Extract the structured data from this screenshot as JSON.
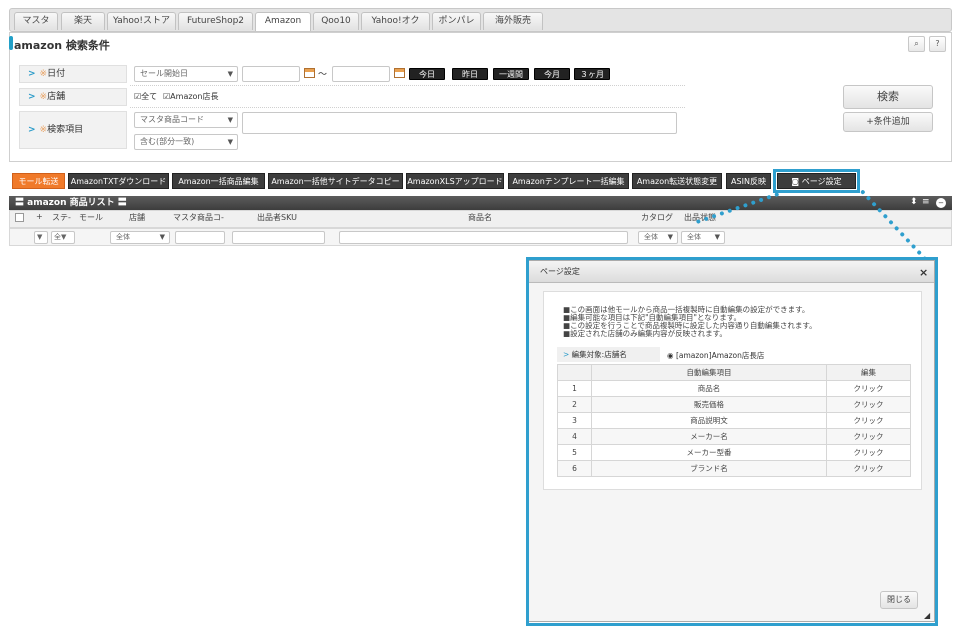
{
  "tabs": [
    "マスタ",
    "楽天",
    "Yahoo!ストア",
    "FutureShop2",
    "Amazon",
    "Qoo10",
    "Yahoo!オク",
    "ポンパレ",
    "海外販売"
  ],
  "active_tab": "Amazon",
  "search": {
    "title": "amazon 検索条件",
    "help_icons": [
      "search-icon",
      "help-icon"
    ],
    "date": {
      "mark": "※",
      "label": "日付",
      "select": "セール開始日",
      "tilde": "～",
      "buttons": [
        "今日",
        "昨日",
        "一週間",
        "今月",
        "３ヶ月"
      ]
    },
    "store": {
      "mark": "※",
      "label": "店舗",
      "check_all": "全て",
      "check_amazon": "Amazon店長"
    },
    "item": {
      "mark": "※",
      "label": "検索項目",
      "select": "マスタ商品コード",
      "match": "含む(部分一致)"
    },
    "search_button": "検索",
    "add_condition_button": "+条件追加"
  },
  "actions": [
    "モール転送",
    "AmazonTXTダウンロード",
    "Amazon一括商品編集",
    "Amazon一括他サイトデータコピー",
    "AmazonXLSアップロード",
    "Amazonテンプレート一括編集",
    "Amazon転送状態変更",
    "ASIN反映",
    "ページ設定"
  ],
  "list": {
    "title": "amazon 商品リスト",
    "columns": [
      "+",
      "ステ-",
      "モール",
      "店舗",
      "マスタ商品コ-",
      "出品者SKU",
      "商品名",
      "カタログ",
      "出品状態"
    ],
    "filter": {
      "f1": "▼",
      "f2": "全▼",
      "store": "全体",
      "catalog": "全体",
      "status": "全体"
    }
  },
  "modal": {
    "title": "ページ設定",
    "close_x": "×",
    "desc": [
      "■この画面は他モールから商品一括複製時に自動編集の設定ができます。",
      "■編集可能な項目は下記\"自動編集項目\"となります。",
      "■この設定を行うことで商品複製時に設定した内容通り自動編集されます。",
      "■設定された店舗のみ編集内容が反映されます。"
    ],
    "target_label": "編集対象:店舗名",
    "target_value": "[amazon]Amazon店長店",
    "table_headers": [
      "",
      "自動編集項目",
      "編集"
    ],
    "rows": [
      {
        "no": "1",
        "item": "商品名",
        "edit": "クリック"
      },
      {
        "no": "2",
        "item": "販売価格",
        "edit": "クリック"
      },
      {
        "no": "3",
        "item": "商品説明文",
        "edit": "クリック"
      },
      {
        "no": "4",
        "item": "メーカー名",
        "edit": "クリック"
      },
      {
        "no": "5",
        "item": "メーカー型番",
        "edit": "クリック"
      },
      {
        "no": "6",
        "item": "ブランド名",
        "edit": "クリック"
      }
    ],
    "close_button": "閉じる"
  },
  "colors": {
    "accent": "#2f9fce",
    "orange": "#f07a2a",
    "dark_button": "#3d3d3d"
  }
}
